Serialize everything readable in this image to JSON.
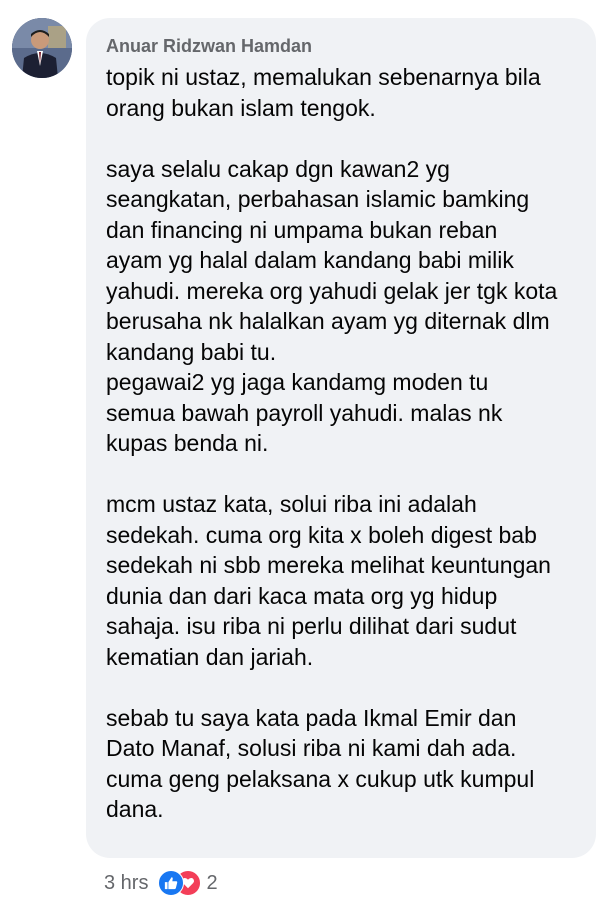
{
  "comment": {
    "author": "Anuar Ridzwan Hamdan",
    "paragraphs": [
      "topik ni ustaz, memalukan sebenarnya bila\norang bukan islam tengok.",
      "saya selalu cakap dgn kawan2 yg\nseangkatan, perbahasan islamic bamking\ndan financing ni umpama bukan reban\nayam yg halal dalam kandang babi milik\nyahudi. mereka org yahudi gelak jer tgk kota\nberusaha nk halalkan ayam yg diternak dlm\nkandang babi tu.\npegawai2 yg jaga kandamg moden tu\nsemua bawah payroll yahudi. malas nk\nkupas benda ni.",
      "mcm ustaz kata, solui riba ini adalah\nsedekah. cuma org kita x boleh digest bab\nsedekah ni sbb mereka melihat keuntungan\ndunia dan dari kaca mata org yg hidup\nsahaja. isu riba ni perlu dilihat dari sudut\nkematian dan jariah.",
      "sebab tu saya kata pada Ikmal Emir dan\nDato Manaf, solusi riba ni kami dah ada.\ncuma geng pelaksana x cukup utk kumpul\ndana."
    ],
    "timestamp": "3 hrs",
    "reactions": {
      "icons": [
        "like-icon",
        "love-icon"
      ],
      "count": "2"
    }
  },
  "colors": {
    "bubble": "#f0f2f5",
    "author": "#65676b",
    "text": "#050505",
    "like": "#1877f2",
    "love": "#f33e58"
  }
}
